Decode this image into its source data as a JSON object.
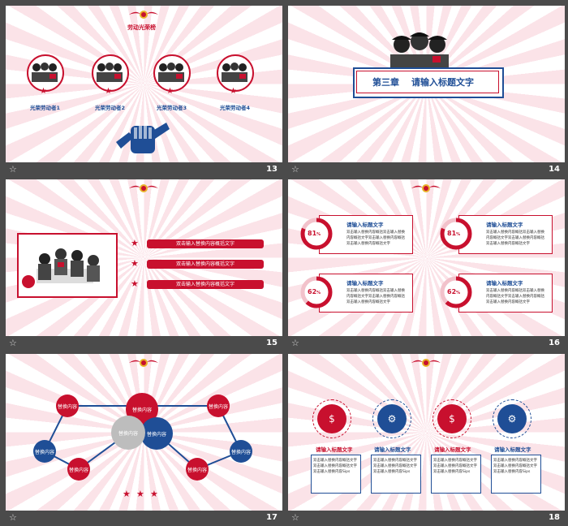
{
  "colors": {
    "red": "#c8102e",
    "blue": "#1f4e96",
    "ray": "#fbe3e8",
    "frame": "#4b4b4b"
  },
  "slides": [
    {
      "number": "13",
      "title": "劳动光荣榜",
      "workers": [
        "光荣劳动者1",
        "光荣劳动者2",
        "光荣劳动者3",
        "光荣劳动者4"
      ]
    },
    {
      "number": "14",
      "chapter": "第三章",
      "heading": "请输入标题文字"
    },
    {
      "number": "15",
      "bars": [
        "双击输入替换内容概括文字",
        "双击输入替换内容概括文字",
        "双击输入替换内容概括文字"
      ]
    },
    {
      "number": "16",
      "cards": [
        {
          "pct": "81",
          "unit": "%",
          "title": "请输入标题文字",
          "body": "双击输入替换内容概括双击输入替换内容概括文字双击输入替换内容概括双击输入替换内容概括文字"
        },
        {
          "pct": "81",
          "unit": "%",
          "title": "请输入标题文字",
          "body": "双击输入替换内容概括双击输入替换内容概括文字双击输入替换内容概括双击输入替换内容概括文字"
        },
        {
          "pct": "62",
          "unit": "%",
          "title": "请输入标题文字",
          "body": "双击输入替换内容概括双击输入替换内容概括文字双击输入替换内容概括双击输入替换内容概括文字"
        },
        {
          "pct": "62",
          "unit": "%",
          "title": "请输入标题文字",
          "body": "双击输入替换内容概括双击输入替换内容概括文字双击输入替换内容概括双击输入替换内容概括文字"
        }
      ]
    },
    {
      "number": "17",
      "label": "替换内容",
      "nodes": [
        "替换内容",
        "替换内容",
        "替换内容",
        "替换内容",
        "替换内容",
        "替换内容",
        "替换内容",
        "替换内容",
        "替换内容"
      ]
    },
    {
      "number": "18",
      "items": [
        {
          "title": "请输入标题文字",
          "body": "双击输入替换内容概括文字双击输入替换内容概括文字双击输入替换内容Sips"
        },
        {
          "title": "请输入标题文字",
          "body": "双击输入替换内容概括文字双击输入替换内容概括文字双击输入替换内容Sips"
        },
        {
          "title": "请输入标题文字",
          "body": "双击输入替换内容概括文字双击输入替换内容概括文字双击输入替换内容Sips"
        },
        {
          "title": "请输入标题文字",
          "body": "双击输入替换内容概括文字双击输入替换内容概括文字双击输入替换内容Sips"
        }
      ],
      "icons": [
        "money-bag-icon",
        "gears-icon",
        "money-bag-icon",
        "gears-icon"
      ]
    }
  ]
}
